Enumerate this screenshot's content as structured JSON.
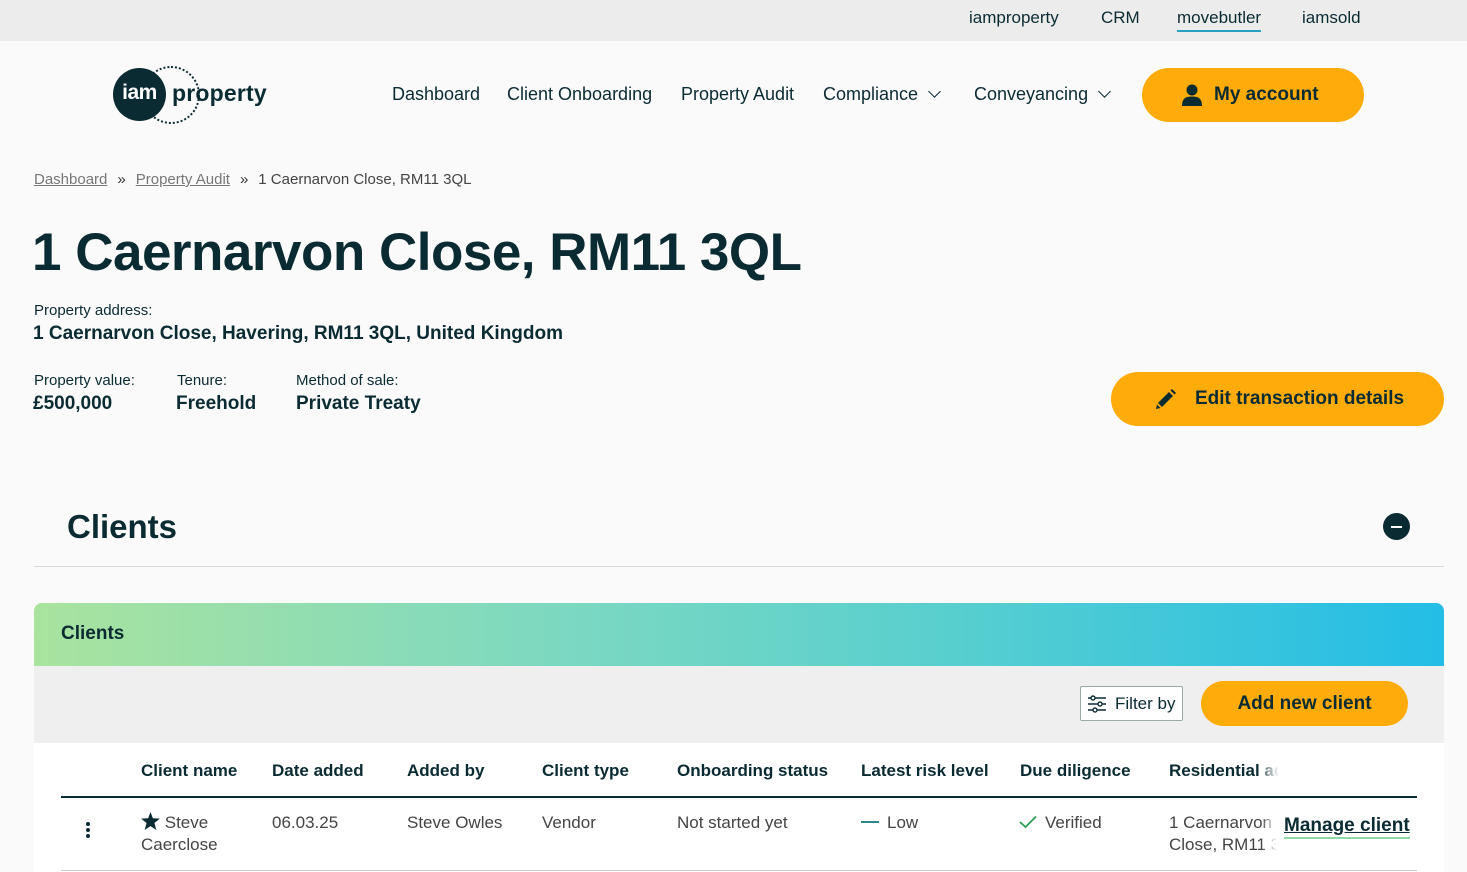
{
  "topbar": {
    "links": [
      "iamproperty",
      "CRM",
      "movebutler",
      "iamsold"
    ],
    "active": "movebutler"
  },
  "logo": {
    "circle_text": "iam",
    "text": "property"
  },
  "nav": {
    "dashboard": "Dashboard",
    "client_onboarding": "Client Onboarding",
    "property_audit": "Property Audit",
    "compliance": "Compliance",
    "conveyancing": "Conveyancing",
    "my_account": "My account"
  },
  "breadcrumb": {
    "items": [
      "Dashboard",
      "Property Audit"
    ],
    "separator": "»",
    "current": "1 Caernarvon Close, RM11 3QL"
  },
  "page": {
    "title": "1 Caernarvon Close, RM11 3QL",
    "address_label": "Property address:",
    "address_value": "1 Caernarvon Close, Havering, RM11 3QL, United Kingdom",
    "value_label": "Property value:",
    "value": "£500,000",
    "tenure_label": "Tenure:",
    "tenure": "Freehold",
    "method_label": "Method of sale:",
    "method": "Private Treaty",
    "edit_button": "Edit transaction details"
  },
  "clients_section": {
    "heading": "Clients",
    "card_title": "Clients",
    "filter_label": "Filter by",
    "add_button": "Add new client",
    "columns": [
      "Client name",
      "Date added",
      "Added by",
      "Client type",
      "Onboarding status",
      "Latest risk level",
      "Due diligence",
      "Residential address"
    ],
    "rows": [
      {
        "name_line1": "Steve",
        "name_line2": "Caerclose",
        "date_added": "06.03.25",
        "added_by": "Steve Owles",
        "client_type": "Vendor",
        "onboarding_status": "Not started yet",
        "risk_level": "Low",
        "due_diligence": "Verified",
        "address_line1": "1 Caernarvon",
        "address_line2": "Close, RM11 3",
        "action": "Manage client"
      }
    ]
  },
  "colors": {
    "accent": "#ffac0a",
    "dark": "#0b2b33",
    "verified": "#2e9e57"
  }
}
